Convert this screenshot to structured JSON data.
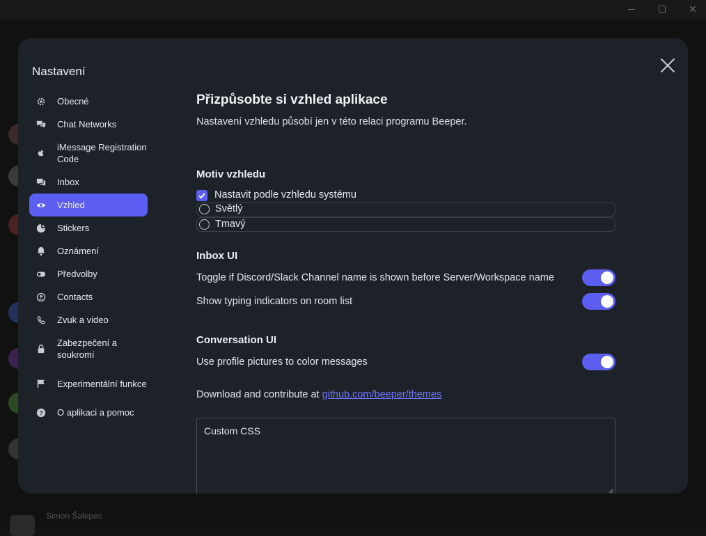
{
  "window": {
    "controls": [
      "minimize-icon",
      "maximize-icon",
      "close-icon"
    ]
  },
  "background_app": {
    "footer_name": "Simon Šalepec"
  },
  "modal": {
    "title": "Nastavení",
    "close_icon": "close-icon"
  },
  "sidebar": {
    "items": [
      {
        "label": "Obecné",
        "icon": "gear-icon"
      },
      {
        "label": "Chat Networks",
        "icon": "chat-bubbles-icon"
      },
      {
        "label": "iMessage Registration Code",
        "icon": "apple-icon"
      },
      {
        "label": "Inbox",
        "icon": "inbox-icon"
      },
      {
        "label": "Vzhled",
        "icon": "eye-icon",
        "active": true
      },
      {
        "label": "Stickers",
        "icon": "sticker-icon"
      },
      {
        "label": "Oznámení",
        "icon": "bell-icon"
      },
      {
        "label": "Předvolby",
        "icon": "toggle-icon"
      },
      {
        "label": "Contacts",
        "icon": "contact-icon"
      },
      {
        "label": "Zvuk a video",
        "icon": "phone-icon"
      },
      {
        "label": "Zabezpečení a soukromí",
        "icon": "lock-icon"
      },
      {
        "label": "Experimentální funkce",
        "icon": "flag-icon"
      },
      {
        "label": "O aplikaci a pomoc",
        "icon": "help-icon"
      }
    ]
  },
  "main": {
    "heading": "Přizpůsobte si vzhled aplikace",
    "subheading": "Nastavení vzhledu působí jen v této relaci programu Beeper.",
    "theme": {
      "heading": "Motiv vzhledu",
      "system_checkbox_label": "Nastavit podle vzhledu systému",
      "system_checked": true,
      "options": [
        "Světlý",
        "Tmavý"
      ]
    },
    "inbox_ui": {
      "heading": "Inbox UI",
      "toggles": [
        {
          "label": "Toggle if Discord/Slack Channel name is shown before Server/Workspace name",
          "on": true
        },
        {
          "label": "Show typing indicators on room list",
          "on": true
        }
      ]
    },
    "conversation_ui": {
      "heading": "Conversation UI",
      "toggles": [
        {
          "label": "Use profile pictures to color messages",
          "on": true
        }
      ]
    },
    "download_text": "Download and contribute at",
    "download_link": "github.com/beeper/themes",
    "custom_css_placeholder": "Custom CSS"
  },
  "colors": {
    "accent": "#5b5ef0",
    "modal_bg": "#1d2128",
    "link": "#7477ff"
  }
}
